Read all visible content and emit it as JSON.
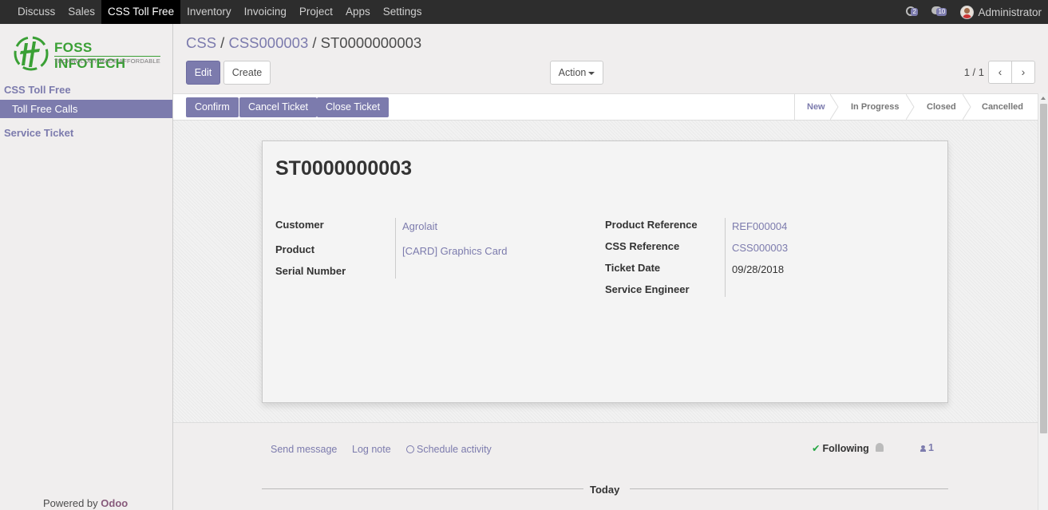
{
  "topnav": {
    "menu": [
      "Discuss",
      "Sales",
      "CSS Toll Free",
      "Inventory",
      "Invoicing",
      "Project",
      "Apps",
      "Settings"
    ],
    "active_index": 2,
    "activity_count": "2",
    "message_count": "10",
    "user": "Administrator"
  },
  "sidebar": {
    "logo_name": "FOSS INFOTECH",
    "logo_tagline": "TECHNOLOGY MADE AFFORDABLE",
    "section1": "CSS Toll Free",
    "section1_item": "Toll Free Calls",
    "section2": "Service Ticket",
    "powered_by": "Powered by",
    "powered_brand": "Odoo"
  },
  "breadcrumb": {
    "item1": "CSS",
    "sep1": " / ",
    "item2": "CSS000003",
    "sep2": " / ",
    "current": "ST0000000003"
  },
  "buttons": {
    "edit": "Edit",
    "create": "Create",
    "action": "Action",
    "pager": "1 / 1",
    "prev_icon": "‹",
    "next_icon": "›"
  },
  "statusbar": {
    "confirm": "Confirm",
    "cancel_ticket": "Cancel Ticket",
    "close_ticket": "Close Ticket",
    "stages": [
      "New",
      "In Progress",
      "Closed",
      "Cancelled"
    ],
    "current_stage": "New"
  },
  "record": {
    "title": "ST0000000003",
    "customer_label": "Customer",
    "customer": "Agrolait",
    "product_label": "Product",
    "product": "[CARD] Graphics Card",
    "serial_label": "Serial Number",
    "serial": "",
    "product_ref_label": "Product Reference",
    "product_ref": "REF000004",
    "css_ref_label": "CSS Reference",
    "css_ref": "CSS000003",
    "ticket_date_label": "Ticket Date",
    "ticket_date": "09/28/2018",
    "engineer_label": "Service Engineer",
    "engineer": ""
  },
  "chatter": {
    "send_message": "Send message",
    "log_note": "Log note",
    "schedule_activity": "Schedule activity",
    "following": "Following",
    "followers": "1",
    "today": "Today"
  },
  "colors": {
    "accent": "#7c7bad",
    "topbar": "#2d2d2d",
    "brand_green": "#3aa035",
    "odoo": "#875a7b"
  }
}
